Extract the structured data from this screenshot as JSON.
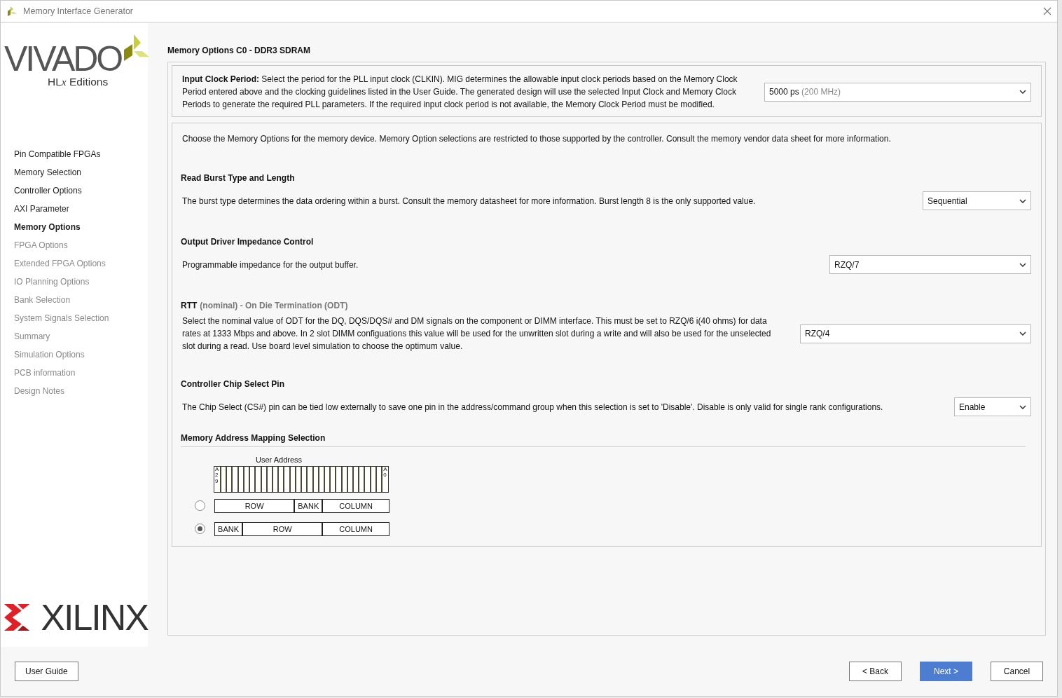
{
  "window": {
    "title": "Memory Interface Generator"
  },
  "logos": {
    "product": "VIVADO",
    "edition_prefix": "HL",
    "edition_x": "x",
    "edition_suffix": " Editions",
    "vendor": "XILINX"
  },
  "sidebar": {
    "items": [
      {
        "label": "Pin Compatible FPGAs",
        "selected": false,
        "disabled": false
      },
      {
        "label": "Memory Selection",
        "selected": false,
        "disabled": false
      },
      {
        "label": "Controller Options",
        "selected": false,
        "disabled": false
      },
      {
        "label": "AXI Parameter",
        "selected": false,
        "disabled": false
      },
      {
        "label": "Memory Options",
        "selected": true,
        "disabled": false
      },
      {
        "label": "FPGA Options",
        "selected": false,
        "disabled": true
      },
      {
        "label": "Extended FPGA Options",
        "selected": false,
        "disabled": true
      },
      {
        "label": "IO Planning Options",
        "selected": false,
        "disabled": true
      },
      {
        "label": "Bank Selection",
        "selected": false,
        "disabled": true
      },
      {
        "label": "System Signals Selection",
        "selected": false,
        "disabled": true
      },
      {
        "label": "Summary",
        "selected": false,
        "disabled": true
      },
      {
        "label": "Simulation Options",
        "selected": false,
        "disabled": true
      },
      {
        "label": "PCB information",
        "selected": false,
        "disabled": true
      },
      {
        "label": "Design Notes",
        "selected": false,
        "disabled": true
      }
    ]
  },
  "page_title": "Memory Options C0 - DDR3 SDRAM",
  "clock": {
    "text": "**Input Clock Period:** Select the period for the PLL input clock (CLKIN). MIG determines the allowable input clock periods based on the Memory Clock Period entered above and the clocking guidelines listed in the User Guide. The generated design will use the selected Input Clock and Memory Clock Periods to generate the required PLL parameters. If the required input clock period is not available, the Memory Clock Period must be modified.",
    "value": "5000 ps",
    "detail": "(200 MHz)"
  },
  "intro": "Choose the Memory Options for the memory device. Memory Option selections are restricted to those supported by the controller. Consult the memory vendor data sheet for more information.",
  "options": [
    {
      "title": "Read Burst Type and Length",
      "description": "The burst type determines the data ordering within a burst. Consult the memory datasheet for more information. Burst length 8 is the only supported value.",
      "value": "Sequential"
    },
    {
      "title": "Output Driver Impedance Control",
      "description": "Programmable impedance for the output buffer.",
      "value": "RZQ/7"
    },
    {
      "title": "RTT",
      "subtitle": "(nominal) - On Die Termination (ODT)",
      "description": "Select the nominal value of ODT for the DQ, DQS/DQS# and DM signals on the component or DIMM interface. This must be set to RZQ/6 i(40 ohms) for data rates at 1333 Mbps and above. In 2 slot DIMM configuations this value will be used for the unwritten slot during a write and will also be used for the unselected slot during a read. Use board level simulation to choose the optimum value.",
      "value": "RZQ/4"
    },
    {
      "title": "Controller Chip Select Pin",
      "description": "The Chip Select (CS#) pin can be tied low externally to save one pin in the address/command group when this selection is set to 'Disable'. Disable is only valid for single rank configurations.",
      "value": "Enable"
    }
  ],
  "mapping": {
    "title": "Memory Address Mapping Selection",
    "caption": "User Address",
    "msb": "A29",
    "lsb": "A0",
    "choices": [
      {
        "selected": false,
        "segments": [
          {
            "kind": "row",
            "label": "ROW"
          },
          {
            "kind": "bank",
            "label": "BANK"
          },
          {
            "kind": "column",
            "label": "COLUMN"
          }
        ]
      },
      {
        "selected": true,
        "segments": [
          {
            "kind": "bank",
            "label": "BANK"
          },
          {
            "kind": "row",
            "label": "ROW"
          },
          {
            "kind": "column",
            "label": "COLUMN"
          }
        ]
      }
    ]
  },
  "buttons": {
    "help": "User Guide",
    "back": "< Back",
    "next": "Next >",
    "cancel": "Cancel"
  }
}
